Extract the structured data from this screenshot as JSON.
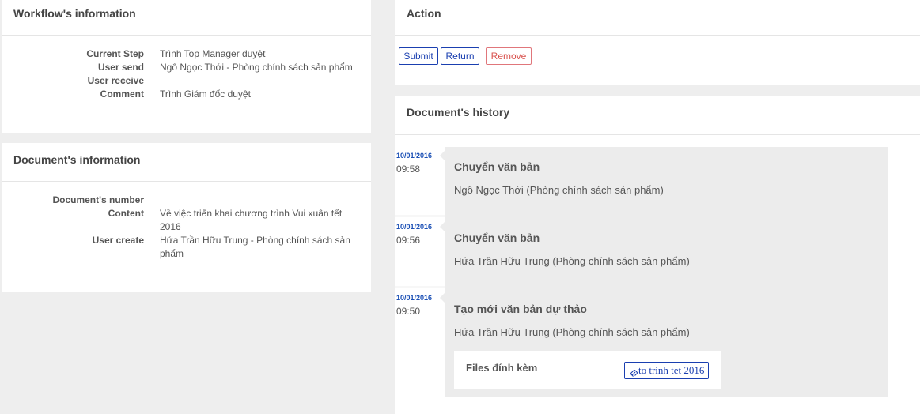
{
  "workflow": {
    "title": "Workflow's information",
    "rows": [
      {
        "label": "Current Step",
        "value": "Trình Top Manager duyệt"
      },
      {
        "label": "User send",
        "value": "Ngô Ngọc Thới - Phòng chính sách sản phẩm"
      },
      {
        "label": "User receive",
        "value": ""
      },
      {
        "label": "Comment",
        "value": "Trình Giám đốc duyệt"
      }
    ]
  },
  "document": {
    "title": "Document's information",
    "rows": [
      {
        "label": "Document's number",
        "value": ""
      },
      {
        "label": "Content",
        "value": "Về việc triển khai chương trình Vui xuân tết 2016"
      },
      {
        "label": "User create",
        "value": "Hứa Trần Hữu Trung - Phòng chính sách sản phẩm"
      }
    ]
  },
  "action": {
    "title": "Action",
    "submit_label": "Submit",
    "return_label": "Return",
    "remove_label": "Remove"
  },
  "history": {
    "title": "Document's history",
    "entries": [
      {
        "date": "10/01/2016",
        "time": "09:58",
        "title": "Chuyển văn bản",
        "user": "Ngô Ngọc Thới (Phòng chính sách sản phẩm)"
      },
      {
        "date": "10/01/2016",
        "time": "09:56",
        "title": "Chuyển văn bản",
        "user": "Hứa Trần Hữu Trung (Phòng chính sách sản phẩm)"
      },
      {
        "date": "10/01/2016",
        "time": "09:50",
        "title": "Tạo mới văn bản dự thảo",
        "user": "Hứa Trần Hữu Trung (Phòng chính sách sản phẩm)"
      }
    ],
    "attachments_label": "Files đính kèm",
    "attachment_file": "to trinh tet 2016",
    "attachment_icon": "paperclip-icon"
  },
  "colors": {
    "accent": "#1a3fb0",
    "danger": "#d9534f",
    "date": "#1a4fb5"
  }
}
